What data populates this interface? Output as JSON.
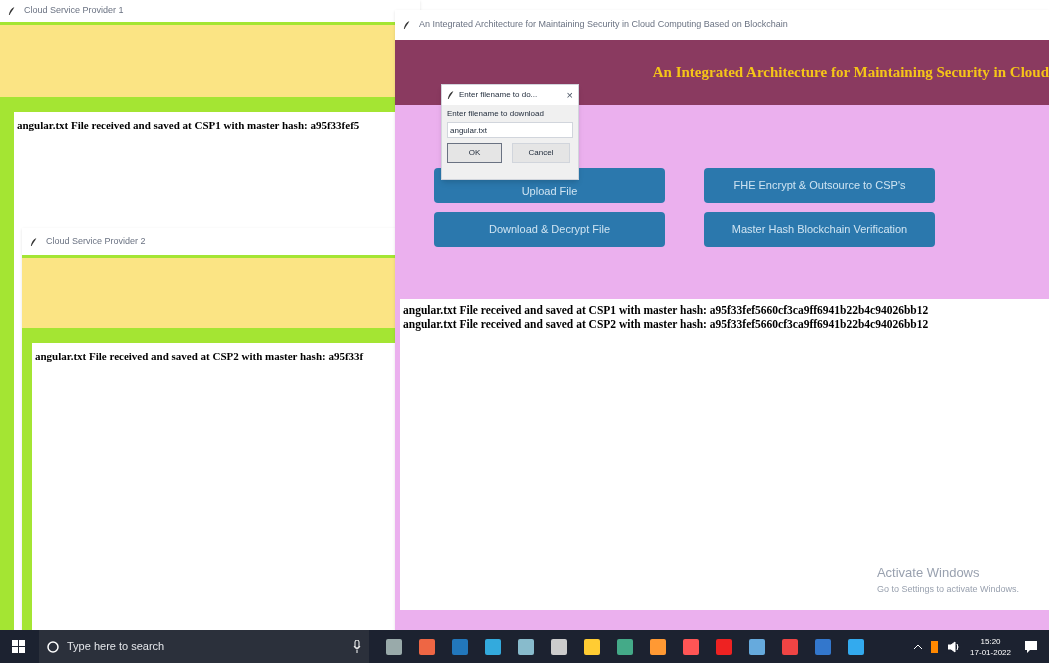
{
  "windows": [
    {
      "title": "Cloud Service Provider 1",
      "log": [
        "angular.txt File received and saved at CSP1 with master hash: a95f33fef5"
      ]
    },
    {
      "title": "Cloud Service Provider 2",
      "log": [
        "angular.txt File received and saved at CSP2 with master hash: a95f33f"
      ]
    }
  ],
  "main_window": {
    "title": "An Integrated Architecture for Maintaining Security in Cloud Computing Based on Blockchain",
    "heading": "An Integrated Architecture for Maintaining Security in Cloud",
    "buttons": [
      "Upload File",
      "FHE Encrypt & Outsource to CSP's",
      "Download & Decrypt File",
      "Master Hash Blockchain Verification"
    ],
    "log": [
      "angular.txt File received and saved at CSP1 with master hash: a95f33fef5660cf3ca9ff6941b22b4c94026bb12",
      "angular.txt File received and saved at CSP2 with master hash: a95f33fef5660cf3ca9ff6941b22b4c94026bb12"
    ]
  },
  "dialog": {
    "title": "Enter filename to do...",
    "close": "×",
    "label": "Enter filename to download",
    "value": "angular.txt",
    "buttons": [
      "OK",
      "Cancel"
    ]
  },
  "activation": {
    "heading": "Activate Windows",
    "text": "Go to Settings to activate Windows."
  },
  "taskbar": {
    "search_placeholder": "Type here to search",
    "time": "15:20",
    "date": "17-01-2022"
  }
}
